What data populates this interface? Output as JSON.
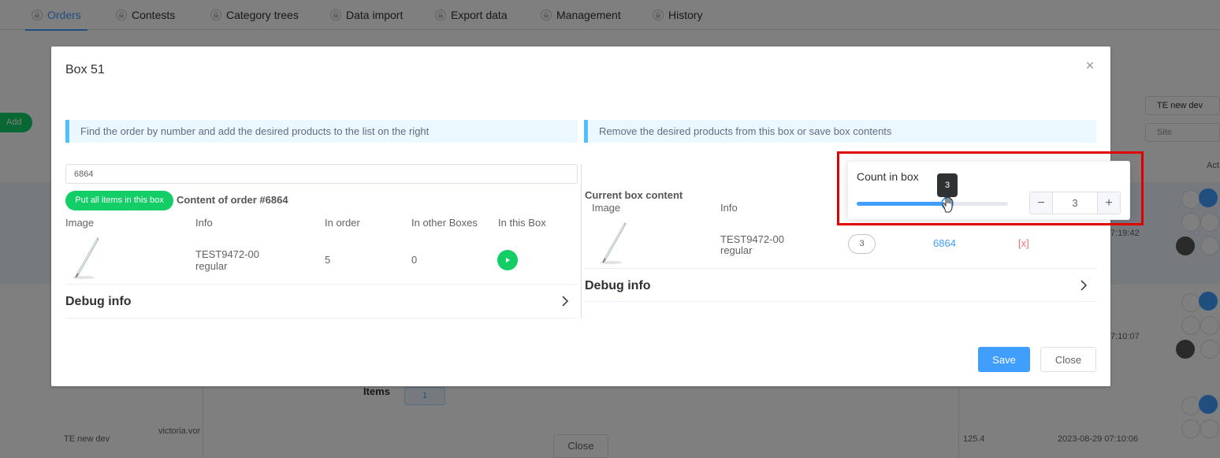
{
  "nav": {
    "tabs": [
      {
        "label": "Orders",
        "active": true
      },
      {
        "label": "Contests"
      },
      {
        "label": "Category trees"
      },
      {
        "label": "Data import"
      },
      {
        "label": "Export data"
      },
      {
        "label": "Management"
      },
      {
        "label": "History"
      }
    ]
  },
  "background": {
    "add_label": "Add",
    "store_select": "TE new dev",
    "site_select": "Site",
    "actions_header": "Act",
    "time1": "7:19:42",
    "time2": "7:10:07",
    "items_label": "Items",
    "items_badge": "1",
    "row_store": "TE new dev",
    "row_user": "victoria.vor",
    "row_amount": "125.4",
    "row_date": "2023-08-29 07:10:06",
    "close_label": "Close"
  },
  "dialog": {
    "title": "Box 51",
    "left_hint": "Find the order by number and add the desired products to the list on the right",
    "right_hint": "Remove the desired products from this box or save box contents",
    "order_input_value": "6864",
    "put_all_label": "Put all items in this box",
    "content_title": "Content of order #6864",
    "order_table": {
      "headers": [
        "Image",
        "Info",
        "In order",
        "In other Boxes",
        "In this Box"
      ],
      "rows": [
        {
          "sku": "TEST9472-00",
          "variant": "regular",
          "in_order": "5",
          "in_other": "0"
        }
      ]
    },
    "debug_left": "Debug info",
    "current_title": "Current box content",
    "box_table": {
      "headers": [
        "Image",
        "Info"
      ],
      "rows": [
        {
          "sku": "TEST9472-00",
          "variant": "regular",
          "count": "3",
          "order": "6864",
          "remove": "[x]"
        }
      ]
    },
    "debug_right": "Debug info",
    "save_label": "Save",
    "close_label": "Close"
  },
  "popover": {
    "label": "Count in box",
    "slider_value": 3,
    "slider_max": 5,
    "tooltip": "3",
    "minus": "−",
    "plus": "+",
    "stepper_value": "3"
  },
  "colors": {
    "accent": "#409eff",
    "success": "#13ce66",
    "danger": "#f56c6c",
    "highlight": "#e00000"
  }
}
